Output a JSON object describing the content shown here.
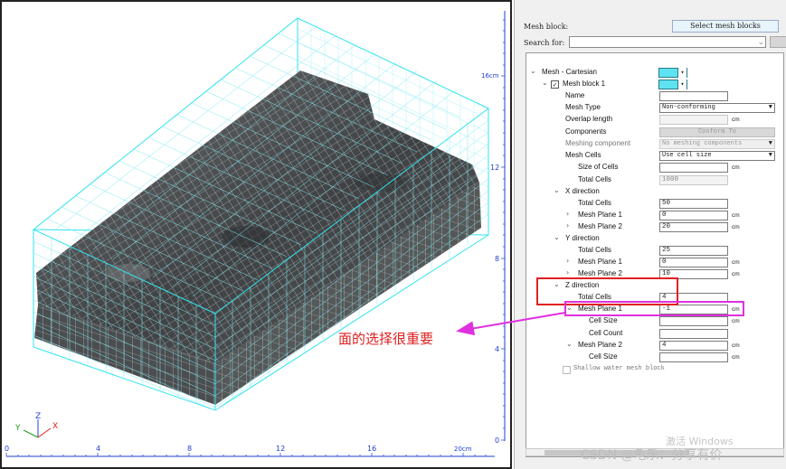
{
  "viewport": {
    "bottom_ruler": [
      "0",
      "4",
      "8",
      "12",
      "16",
      "20cm"
    ],
    "right_ruler": [
      "16cm",
      "12",
      "8",
      "4",
      "0"
    ],
    "axis_labels": {
      "x": "X",
      "y": "Y",
      "z": "Z"
    },
    "colors": {
      "mesh_box": "#31e3ee",
      "solid": "#505355",
      "grid": "#c8d0d0",
      "ruler": "#1f3fd0"
    }
  },
  "panel": {
    "mesh_block_label": "Mesh block:",
    "select_button": "Select  mesh blocks",
    "search_label": "Search for:",
    "search_value": "",
    "tree": {
      "mesh_cartesian": "Mesh - Cartesian",
      "mesh_block_1": "Mesh block 1",
      "name": {
        "label": "Name",
        "value": ""
      },
      "mesh_type": {
        "label": "Mesh Type",
        "value": "Non-conforming"
      },
      "overlap_length": {
        "label": "Overlap length",
        "value": "",
        "unit": "cm"
      },
      "components": {
        "label": "Components",
        "button": "Conform To"
      },
      "meshing_component": {
        "label": "Meshing component",
        "value": "No meshing components"
      },
      "mesh_cells": {
        "label": "Mesh Cells",
        "value": "Use cell size"
      },
      "size_of_cells": {
        "label": "Size of Cells",
        "value": "",
        "unit": "cm"
      },
      "total_cells": {
        "label": "Total Cells",
        "value": "1000"
      },
      "x_direction": {
        "label": "X direction",
        "total_cells": {
          "label": "Total Cells",
          "value": "50"
        },
        "plane1": {
          "label": "Mesh Plane 1",
          "value": "0",
          "unit": "cm"
        },
        "plane2": {
          "label": "Mesh Plane 2",
          "value": "20",
          "unit": "cm"
        }
      },
      "y_direction": {
        "label": "Y direction",
        "total_cells": {
          "label": "Total Cells",
          "value": "25"
        },
        "plane1": {
          "label": "Mesh Plane 1",
          "value": "0",
          "unit": "cm"
        },
        "plane2": {
          "label": "Mesh Plane 2",
          "value": "10",
          "unit": "cm"
        }
      },
      "z_direction": {
        "label": "Z direction",
        "total_cells": {
          "label": "Total Cells",
          "value": "4"
        },
        "plane1": {
          "label": "Mesh Plane 1",
          "value": "-1",
          "unit": "cm"
        },
        "plane1_cell_size": {
          "label": "Cell Size",
          "value": "",
          "unit": "cm"
        },
        "plane1_cell_count": {
          "label": "Cell Count",
          "value": ""
        },
        "plane2": {
          "label": "Mesh Plane 2",
          "value": "4",
          "unit": "cm"
        },
        "plane2_cell_size": {
          "label": "Cell Size",
          "value": "",
          "unit": "cm"
        }
      },
      "shallow_water": "Shallow water mesh block"
    }
  },
  "annotation": {
    "text": "面的选择很重要",
    "color": "#e02020",
    "arrow_color": "#e030e0"
  },
  "watermarks": {
    "windows": "激活 Windows",
    "csdn": "CSDN @龟乐：分享有价"
  }
}
